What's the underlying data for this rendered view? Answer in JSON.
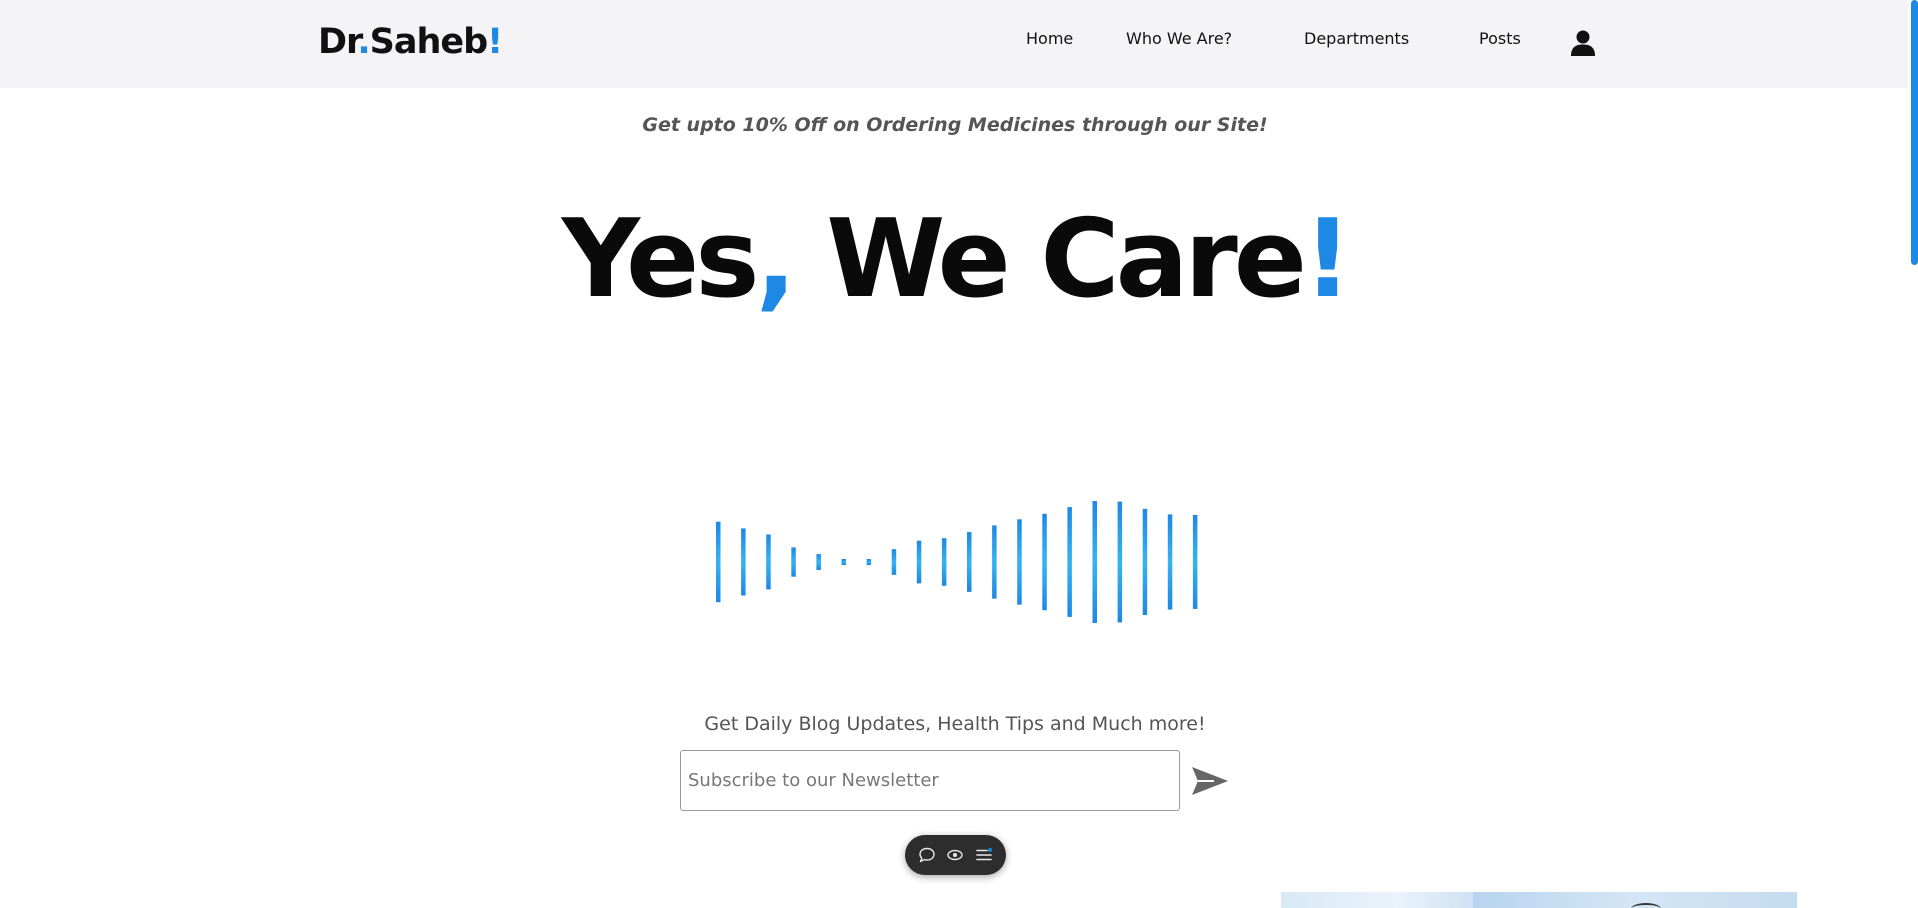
{
  "header": {
    "logo": {
      "part1": "Dr",
      "dot": ".",
      "part2": "Saheb",
      "bang": "!"
    },
    "nav": [
      {
        "label": "Home"
      },
      {
        "label": "Who We Are?"
      },
      {
        "label": "Departments"
      },
      {
        "label": "Posts"
      }
    ],
    "user_icon": "user-icon"
  },
  "promo": {
    "text": "Get upto 10% Off on Ordering Medicines through our Site!"
  },
  "hero": {
    "part1": "Yes",
    "comma": ",",
    "part2": " We Care",
    "bang": "!"
  },
  "wave": {
    "levels": [
      0.66,
      0.55,
      0.45,
      0.24,
      0.13,
      0.05,
      0.05,
      0.21,
      0.35,
      0.39,
      0.49,
      0.6,
      0.7,
      0.79,
      0.9,
      1.0,
      0.99,
      0.87,
      0.78,
      0.77
    ]
  },
  "newsletter": {
    "label": "Get Daily Blog Updates, Health Tips and Much more!",
    "placeholder": "Subscribe to our Newsletter",
    "value": ""
  },
  "toolbar": {
    "buttons": [
      {
        "icon": "comment-icon"
      },
      {
        "icon": "eye-icon"
      },
      {
        "icon": "menu-icon"
      }
    ]
  },
  "colors": {
    "accent": "#1e88e5",
    "header_bg": "#f4f4f6",
    "text": "#111111",
    "muted": "#555555"
  }
}
